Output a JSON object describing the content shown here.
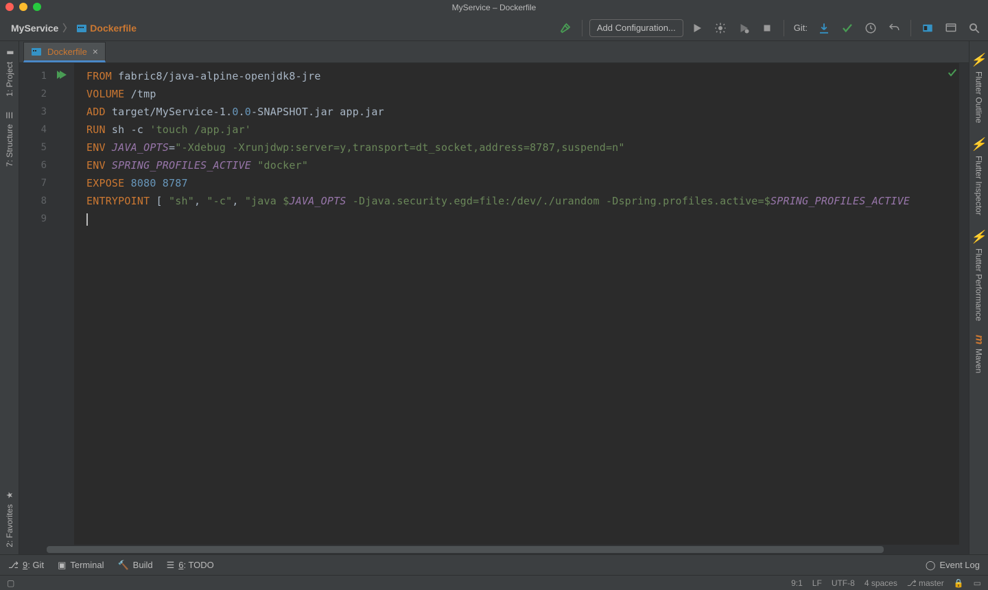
{
  "window": {
    "title": "MyService – Dockerfile"
  },
  "breadcrumb": {
    "project": "MyService",
    "file": "Dockerfile"
  },
  "toolbar": {
    "add_config": "Add Configuration...",
    "git_label": "Git:"
  },
  "tabs": [
    {
      "name": "Dockerfile"
    }
  ],
  "left_gutter": {
    "project": "1: Project",
    "structure": "7: Structure",
    "favorites": "2: Favorites"
  },
  "right_gutter": {
    "flutter_outline": "Flutter Outline",
    "flutter_inspector": "Flutter Inspector",
    "flutter_performance": "Flutter Performance",
    "maven": "Maven"
  },
  "editor": {
    "lines": [
      "1",
      "2",
      "3",
      "4",
      "5",
      "6",
      "7",
      "8",
      "9"
    ],
    "code": {
      "l1": {
        "kw": "FROM",
        "rest": " fabric8/java-alpine-openjdk8-jre"
      },
      "l2": {
        "kw": "VOLUME",
        "path": " /tmp"
      },
      "l3": {
        "kw": "ADD",
        "a": " target/MyService-1",
        "dot1": ".",
        "n1": "0",
        "dot2": ".",
        "n2": "0",
        "b": "-SNAPSHOT.jar app.jar"
      },
      "l4": {
        "kw": "RUN",
        "sh": " sh ",
        "flag": "-c ",
        "str": "'touch /app.jar'"
      },
      "l5": {
        "kw": "ENV",
        "var": " JAVA_OPTS",
        "eq": "=",
        "str": "\"-Xdebug -Xrunjdwp:server=y,transport=dt_socket,address=8787,suspend=n\""
      },
      "l6": {
        "kw": "ENV",
        "var": " SPRING_PROFILES_ACTIVE",
        "sp": " ",
        "str": "\"docker\""
      },
      "l7": {
        "kw": "EXPOSE",
        "sp": " ",
        "p1": "8080",
        "sp2": " ",
        "p2": "8787"
      },
      "l8": {
        "kw": "ENTRYPOINT",
        "br": " [ ",
        "s1": "\"sh\"",
        "c1": ", ",
        "s2": "\"-c\"",
        "c2": ", ",
        "s3a": "\"java ",
        "d": "$",
        "v1": "JAVA_OPTS",
        "s3b": " -Djava.security.egd=file:/dev/./urandom -Dspring.profiles.active=",
        "d2": "$",
        "v2": "SPRING_PROFILES_ACTIVE"
      }
    }
  },
  "bottom": {
    "git": "9: Git",
    "terminal": "Terminal",
    "build": "Build",
    "todo": "6: TODO",
    "event_log": "Event Log"
  },
  "status": {
    "pos": "9:1",
    "lf": "LF",
    "enc": "UTF-8",
    "indent": "4 spaces",
    "branch": "master"
  }
}
